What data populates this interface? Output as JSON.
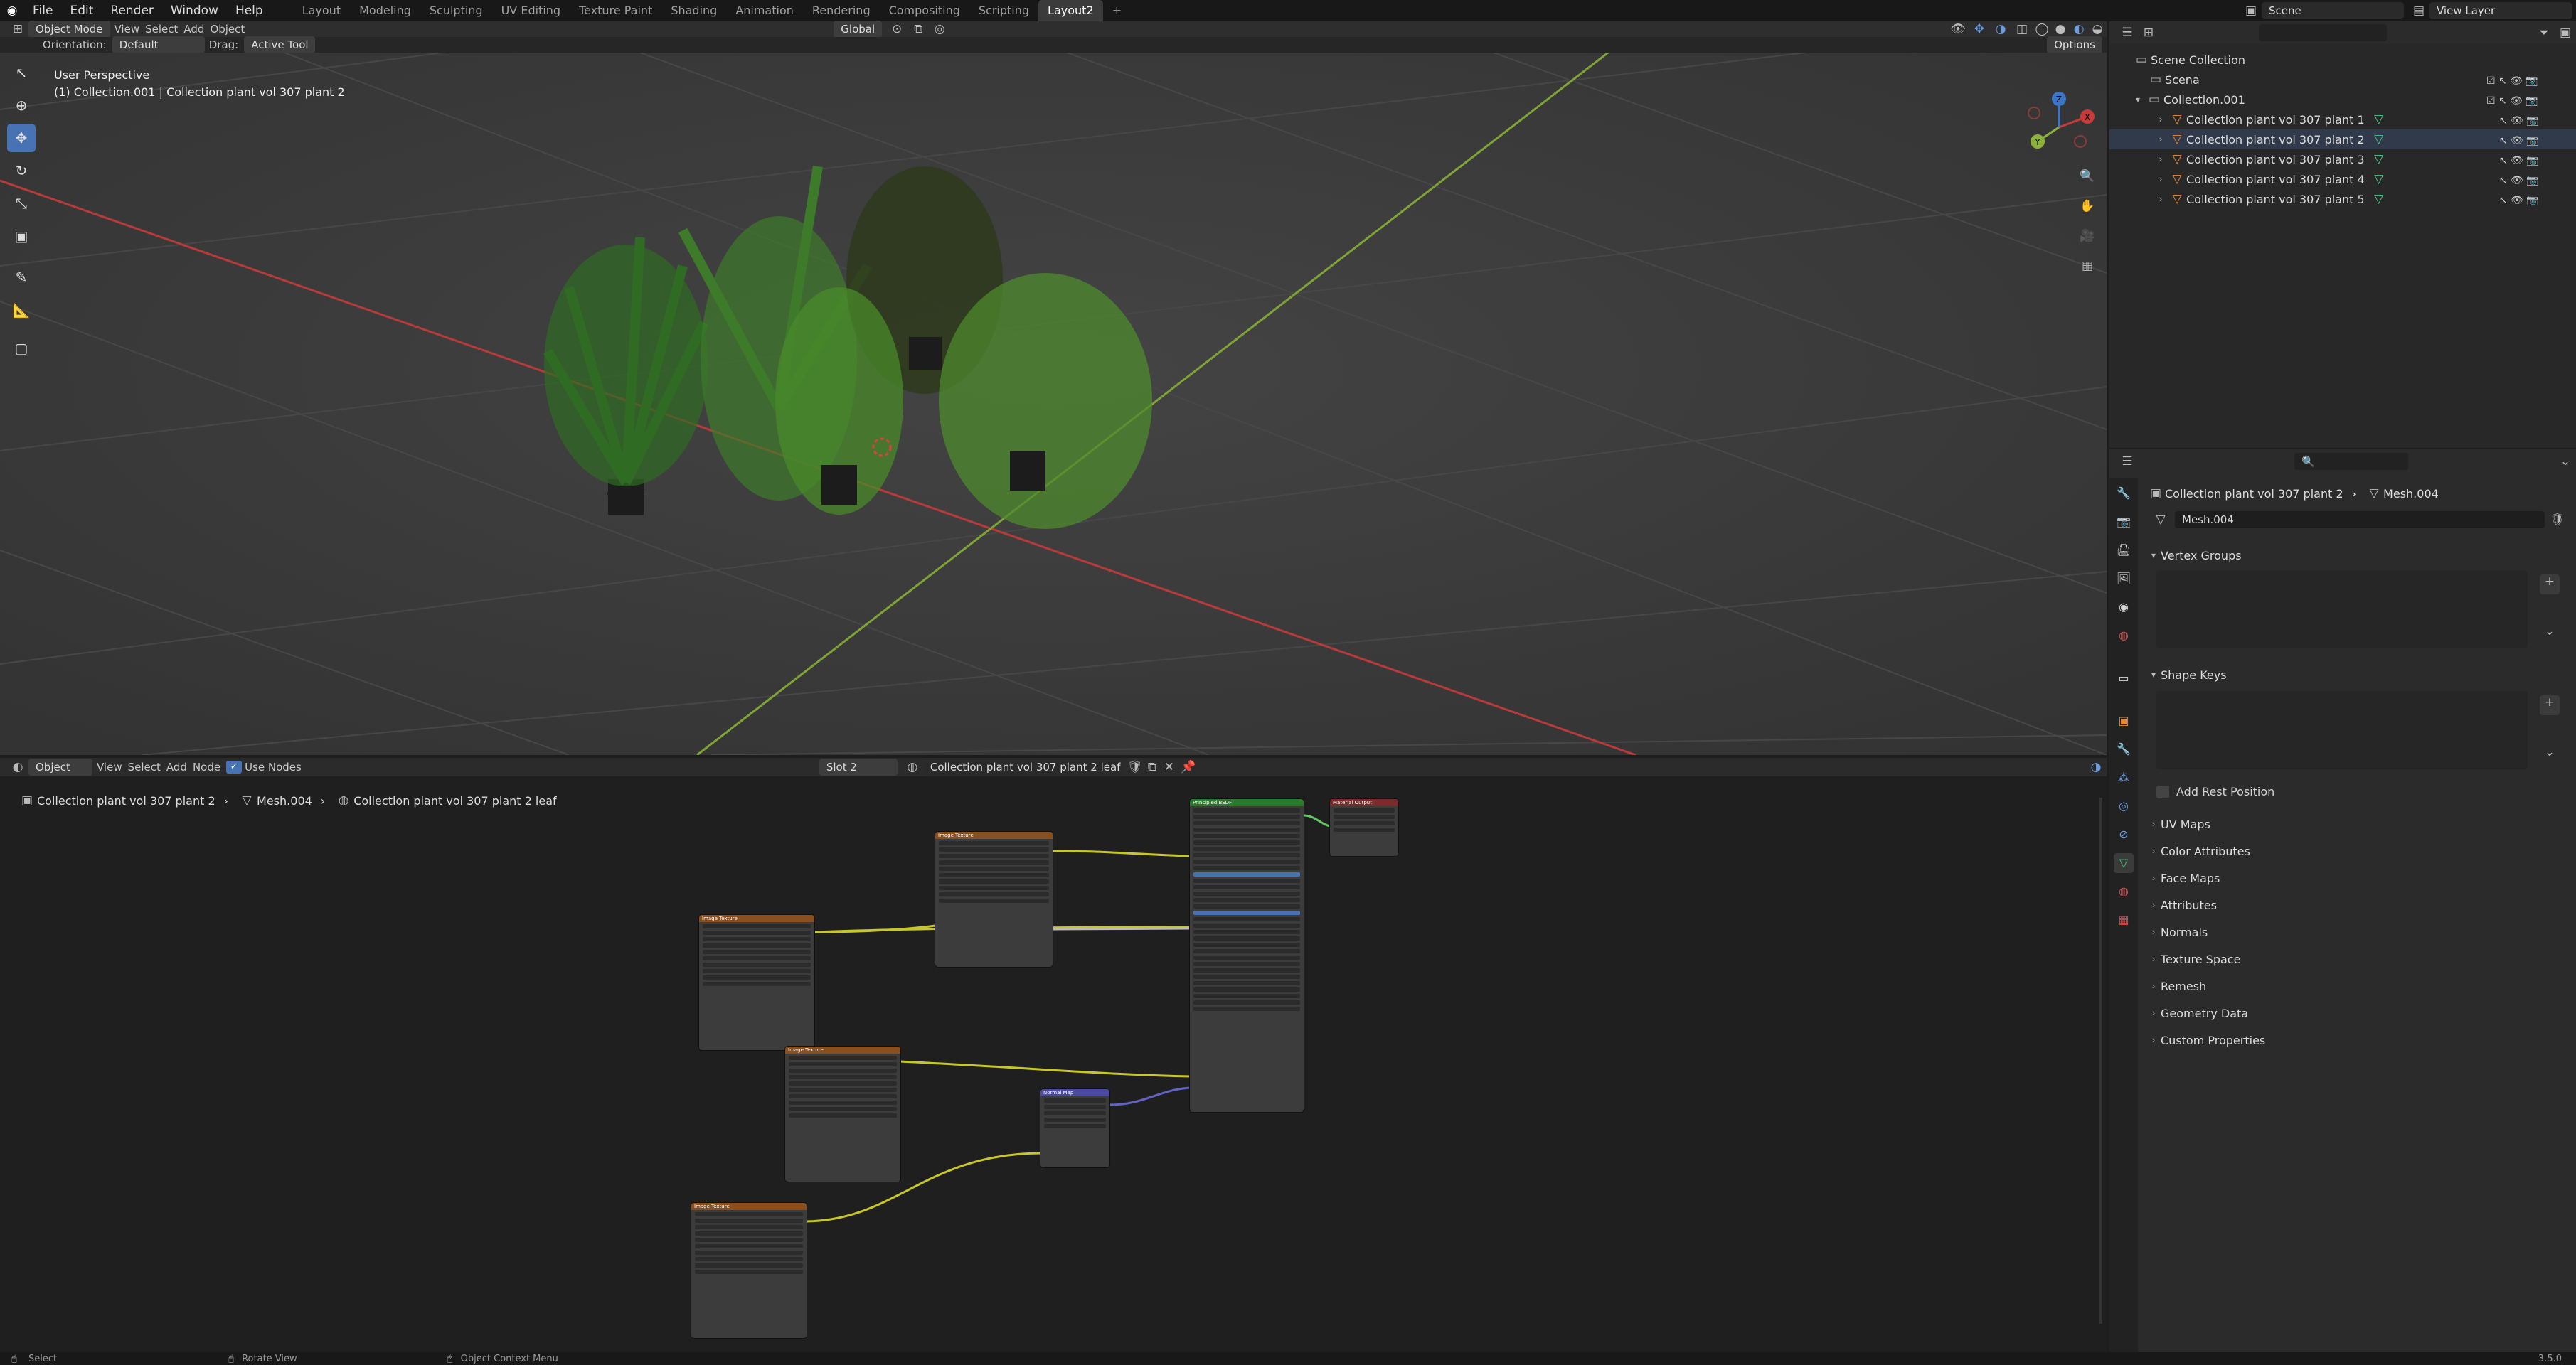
{
  "topbar": {
    "menus": [
      "File",
      "Edit",
      "Render",
      "Window",
      "Help"
    ],
    "workspaces": [
      "Layout",
      "Modeling",
      "Sculpting",
      "UV Editing",
      "Texture Paint",
      "Shading",
      "Animation",
      "Rendering",
      "Compositing",
      "Scripting",
      "Layout2"
    ],
    "add_tab": "+",
    "scene_label": "Scene",
    "view_layer_label": "View Layer"
  },
  "viewport_header": {
    "mode": "Object Mode",
    "menus": [
      "View",
      "Select",
      "Add",
      "Object"
    ],
    "transform_orientation": "Global",
    "orientation_label": "Orientation:",
    "orientation_value": "Default",
    "drag_label": "Drag:",
    "drag_value": "Active Tool",
    "options_label": "Options"
  },
  "viewport": {
    "perspective_label": "User Perspective",
    "selection_label": "(1) Collection.001 | Collection plant vol 307 plant 2",
    "gizmo_axes": [
      "X",
      "Y",
      "Z"
    ]
  },
  "node_editor_header": {
    "editor_type": "Object",
    "menus": [
      "View",
      "Select",
      "Add",
      "Node"
    ],
    "use_nodes_label": "Use Nodes",
    "use_nodes_checked": true,
    "slot": "Slot 2",
    "material_name": "Collection plant vol 307 plant 2 leaf"
  },
  "node_breadcrumb": {
    "object": "Collection plant vol 307 plant 2",
    "mesh": "Mesh.004",
    "material": "Collection plant vol 307 plant 2 leaf"
  },
  "nodes": {
    "image_texture_title": "Image Texture",
    "bsdf_title": "Principled BSDF",
    "output_title": "Material Output",
    "normal_map_title": "Normal Map",
    "color_socket": "Color",
    "alpha_socket": "Alpha",
    "normal_socket": "Normal",
    "vector_socket": "Vector",
    "strength_label": "Strength",
    "strength_value": "1.000"
  },
  "outliner": {
    "search_placeholder": "",
    "root": "Scene Collection",
    "items": [
      {
        "label": "Scena",
        "indent": 1
      },
      {
        "label": "Collection.001",
        "indent": 1
      },
      {
        "label": "Collection plant vol 307 plant 1",
        "indent": 2
      },
      {
        "label": "Collection plant vol 307 plant 2",
        "indent": 2
      },
      {
        "label": "Collection plant vol 307 plant 3",
        "indent": 2
      },
      {
        "label": "Collection plant vol 307 plant 4",
        "indent": 2
      },
      {
        "label": "Collection plant vol 307 plant 5",
        "indent": 2
      }
    ]
  },
  "properties": {
    "breadcrumb_object": "Collection plant vol 307 plant 2",
    "breadcrumb_mesh": "Mesh.004",
    "mesh_name": "Mesh.004",
    "vertex_groups_label": "Vertex Groups",
    "shape_keys_label": "Shape Keys",
    "add_rest_position_label": "Add Rest Position",
    "panels": [
      "UV Maps",
      "Color Attributes",
      "Face Maps",
      "Attributes",
      "Normals",
      "Texture Space",
      "Remesh",
      "Geometry Data",
      "Custom Properties"
    ]
  },
  "statusbar": {
    "items": [
      "Select",
      "Rotate View",
      "Object Context Menu"
    ],
    "version": "3.5.0"
  },
  "colors": {
    "accent": "#4772b3",
    "active_object_orange": "#e8893a",
    "x_axis": "#c83a3a",
    "y_axis": "#8bb33a",
    "z_axis": "#3a77c8"
  }
}
